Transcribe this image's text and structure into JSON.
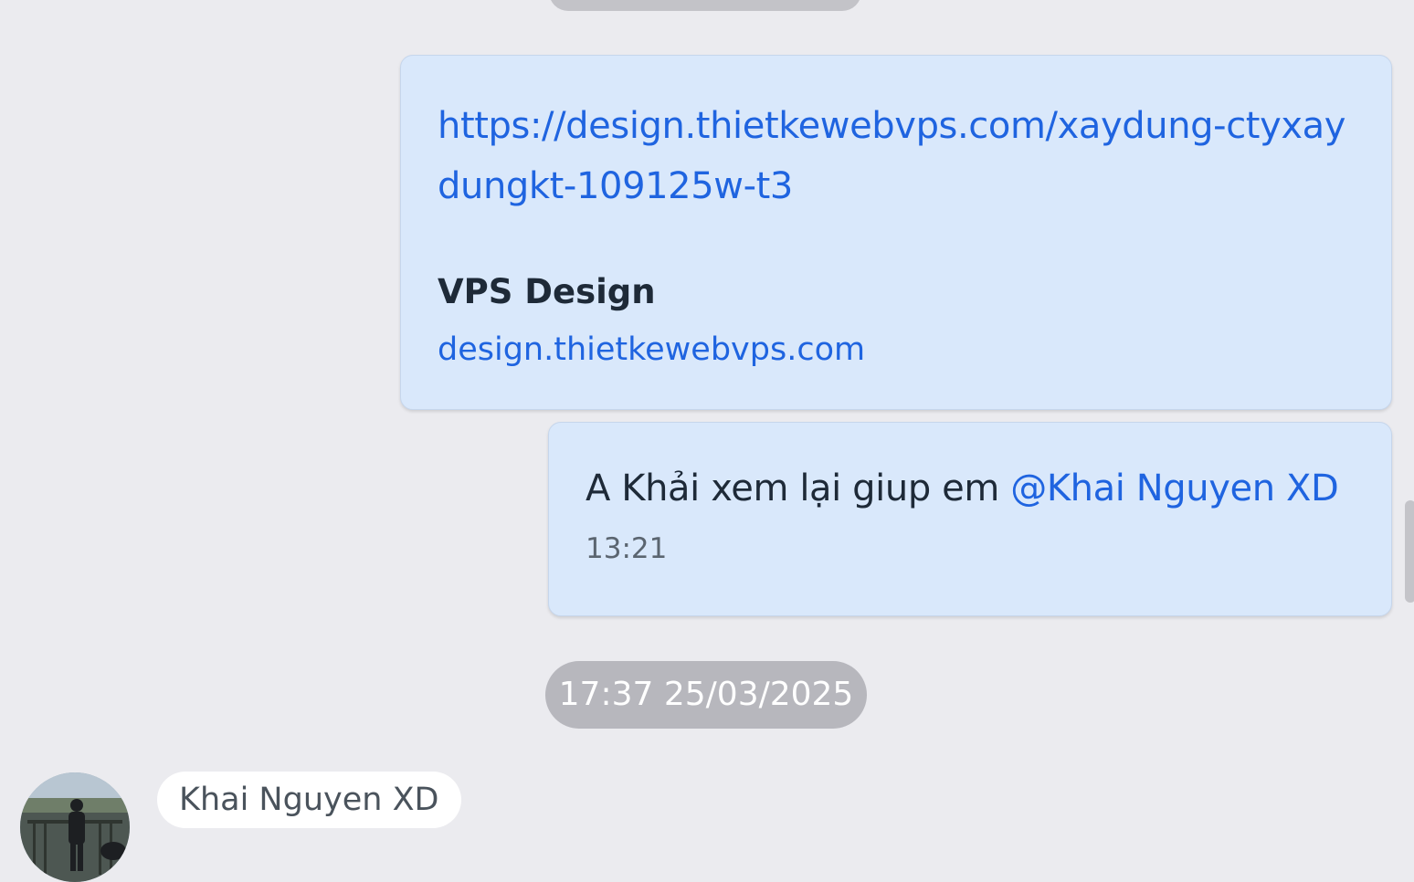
{
  "messages": {
    "link_message": {
      "url": "https://design.thietkewebvps.com/xaydung-ctyxaydungkt-109125w-t3",
      "preview_title": "VPS Design",
      "preview_domain": "design.thietkewebvps.com"
    },
    "text_message": {
      "text": "A Khải xem lại giup em ",
      "mention": "@Khai Nguyen XD",
      "time": "13:21"
    }
  },
  "date_separator": "17:37 25/03/2025",
  "next_sender": {
    "name": "Khai Nguyen XD"
  },
  "colors": {
    "background": "#ebebef",
    "bubble": "#d9e8fb",
    "link": "#1f64e0",
    "date_pill": "#b7b7bd"
  }
}
